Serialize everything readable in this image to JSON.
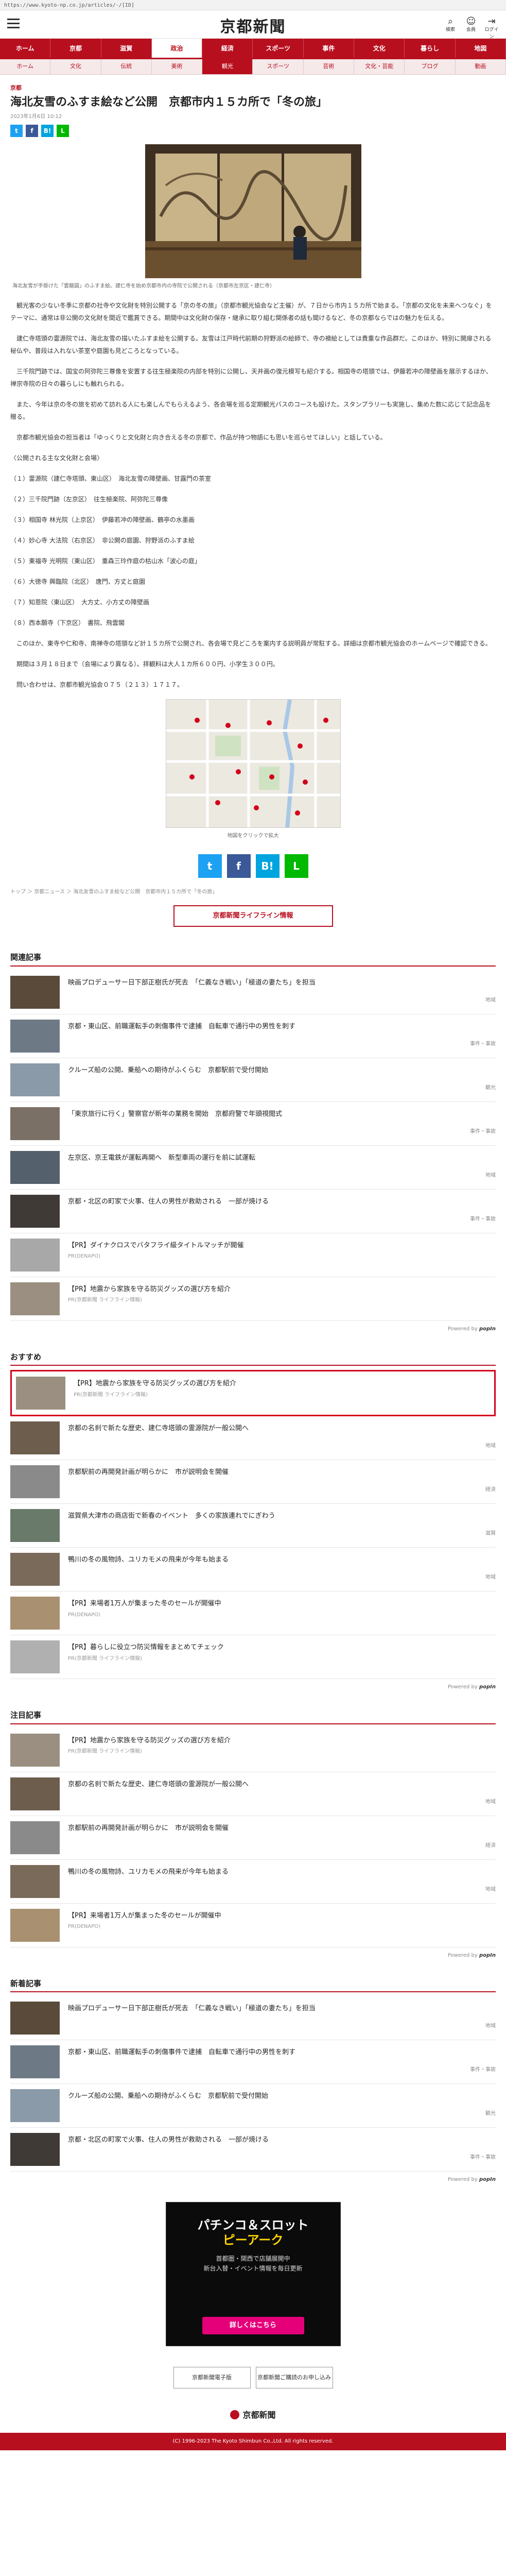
{
  "browser": {
    "url": "https://www.kyoto-np.co.jp/articles/-/[ID]"
  },
  "header": {
    "logo": "京都新聞",
    "icons": [
      {
        "label": "検索",
        "glyph": "⌕"
      },
      {
        "label": "会員",
        "glyph": "☺"
      },
      {
        "label": "ログイン",
        "glyph": "⇥"
      }
    ]
  },
  "global_nav": [
    {
      "label": "ホーム",
      "active": false
    },
    {
      "label": "京都",
      "active": false
    },
    {
      "label": "滋賀",
      "active": false
    },
    {
      "label": "政治",
      "active": true
    },
    {
      "label": "経済",
      "active": false
    },
    {
      "label": "スポーツ",
      "active": false
    },
    {
      "label": "事件",
      "active": false
    },
    {
      "label": "文化",
      "active": false
    },
    {
      "label": "暮らし",
      "active": false
    },
    {
      "label": "地図",
      "active": false
    }
  ],
  "sub_nav": [
    {
      "label": "ホーム",
      "active": false
    },
    {
      "label": "文化",
      "active": false
    },
    {
      "label": "伝統",
      "active": false
    },
    {
      "label": "美術",
      "active": false
    },
    {
      "label": "観光",
      "active": true
    },
    {
      "label": "スポーツ",
      "active": false
    },
    {
      "label": "芸術",
      "active": false
    },
    {
      "label": "文化・芸能",
      "active": false
    },
    {
      "label": "ブログ",
      "active": false
    },
    {
      "label": "動画",
      "active": false
    }
  ],
  "article": {
    "category": "京都",
    "headline": "海北友雪のふすま絵など公開　京都市内１５カ所で「冬の旅」",
    "pubdate": "2023年1月6日 10:12",
    "share": [
      {
        "name": "twitter",
        "glyph": "t",
        "color": "#1da1f2"
      },
      {
        "name": "facebook",
        "glyph": "f",
        "color": "#3b5998"
      },
      {
        "name": "hatena",
        "glyph": "B!",
        "color": "#00a4de"
      },
      {
        "name": "line",
        "glyph": "L",
        "color": "#00b900"
      }
    ],
    "photo_caption": "海北友雪が手掛けた「雲龍図」のふすま絵。建仁寺を始め京都市内の寺院で公開される（京都市左京区・建仁寺）",
    "paragraphs": [
      "観光客の少ない冬季に京都の社寺や文化財を特別公開する「京の冬の旅」（京都市観光協会など主催）が、７日から市内１５カ所で始まる。「京都の文化を未来へつなぐ」をテーマに、通常は非公開の文化財を間近で鑑賞できる。期間中は文化財の保存・継承に取り組む関係者の話も聞けるなど、冬の京都ならではの魅力を伝える。",
      "建仁寺塔頭の霊源院では、海北友雪の描いたふすま絵を公開する。友雪は江戸時代前期の狩野派の絵師で、寺の襖絵としては貴重な作品群だ。このほか、特別に開扉される秘仏や、普段は入れない茶室や庭園も見どころとなっている。",
      "三千院門跡では、国宝の阿弥陀三尊像を安置する往生極楽院の内部を特別に公開し、天井画の復元模写も紹介する。相国寺の塔頭では、伊藤若冲の障壁画を展示するほか、禅宗寺院の日々の暮らしにも触れられる。",
      "また、今年は京の冬の旅を初めて訪れる人にも楽しんでもらえるよう、各会場を巡る定期観光バスのコースも設けた。スタンプラリーも実施し、集めた数に応じて記念品を贈る。",
      "京都市観光協会の担当者は「ゆっくりと文化財と向き合える冬の京都で、作品が持つ物語にも思いを巡らせてほしい」と話している。",
      "〈公開される主な文化財と会場〉",
      "（１）霊源院（建仁寺塔頭、東山区）　海北友雪の障壁画、甘露門の茶室",
      "（２）三千院門跡（左京区）　往生極楽院、阿弥陀三尊像",
      "（３）相国寺 林光院（上京区）　伊藤若冲の障壁画、鶴亭の水墨画",
      "（４）妙心寺 大法院（右京区）　非公開の庭園、狩野派のふすま絵",
      "（５）東福寺 光明院（東山区）　重森三玲作庭の枯山水「波心の庭」",
      "（６）大徳寺 興臨院（北区）　唐門、方丈と庭園",
      "（７）知恩院（東山区）　大方丈、小方丈の障壁画",
      "（８）西本願寺（下京区）　書院、飛雲閣",
      "このほか、東寺や仁和寺、南禅寺の塔頭など計１５カ所で公開され、各会場で見どころを案内する説明員が常駐する。詳細は京都市観光協会のホームページで確認できる。",
      "期間は３月１８日まで（会場により異なる）。拝観料は大人１カ所６００円、小学生３００円。",
      "問い合わせは、京都市観光協会０７５（２１３）１７１７。"
    ],
    "map_caption": "地図をクリックで拡大"
  },
  "breadcrumb": "トップ ＞ 京都ニュース ＞ 海北友雪のふすま絵など公開　京都市内１５カ所で「冬の旅」",
  "lifeinfo_button": "京都新聞ライフライン情報",
  "sections": [
    {
      "title": "関連記事",
      "items": [
        {
          "text": "映画プロデューサー日下部正樹氏が死去　「仁義なき戦い」「極道の妻たち」を担当",
          "meta": "地域",
          "thumb": "#5a4a3a"
        },
        {
          "text": "京都・東山区、前職運転手の刺傷事件で逮捕　自転車で通行中の男性を刺す",
          "meta": "事件・事故",
          "thumb": "#6d7a86"
        },
        {
          "text": "クルーズ船の公開、乗船への期待がふくらむ　京都駅前で受付開始",
          "meta": "観光",
          "thumb": "#8a9aa8"
        },
        {
          "text": "「東京旅行に行く」警察官が新年の業務を開始　京都府警で年頭視閲式",
          "meta": "事件・事故",
          "thumb": "#7b7066"
        },
        {
          "text": "左京区、京王電鉄が運転再開へ　新型車両の運行を前に試運転",
          "meta": "地域",
          "thumb": "#54606b"
        },
        {
          "text": "京都・北区の町家で火事、住人の男性が救助される　一部が焼ける",
          "meta": "事件・事故",
          "thumb": "#3f3a36"
        },
        {
          "text": "【PR】ダイナクロスでバタフライ級タイトルマッチが開催",
          "meta": "",
          "thumb": "#a8a8a8",
          "promo": "PR(DENAPO)"
        },
        {
          "text": "【PR】地震から家族を守る防災グッズの選び方を紹介",
          "meta": "",
          "thumb": "#9a8f80",
          "promo": "PR(京都新聞 ライフライン情報)"
        }
      ]
    },
    {
      "title": "おすすめ",
      "items": [
        {
          "text": "【PR】地震から家族を守る防災グッズの選び方を紹介",
          "meta": "",
          "thumb": "#9a8f80",
          "promo": "PR(京都新聞 ライフライン情報)",
          "highlight": true
        },
        {
          "text": "京都の名刹で新たな歴史、建仁寺塔頭の霊源院が一般公開へ",
          "meta": "地域",
          "thumb": "#6d5d4d"
        },
        {
          "text": "京都駅前の再開発計画が明らかに　市が説明会を開催",
          "meta": "経済",
          "thumb": "#8a8a8a"
        },
        {
          "text": "滋賀県大津市の商店街で新春のイベント　多くの家族連れでにぎわう",
          "meta": "滋賀",
          "thumb": "#6a7a6a"
        },
        {
          "text": "鴨川の冬の風物詩、ユリカモメの飛来が今年も始まる",
          "meta": "地域",
          "thumb": "#7a6a5a"
        },
        {
          "text": "【PR】来場者1万人が集まった冬のセールが開催中",
          "meta": "",
          "thumb": "#a89070",
          "promo": "PR(DENAPO)"
        },
        {
          "text": "【PR】暮らしに役立つ防災情報をまとめてチェック",
          "meta": "",
          "thumb": "#b0b0b0",
          "promo": "PR(京都新聞 ライフライン情報)"
        }
      ]
    },
    {
      "title": "注目記事",
      "items": [
        {
          "text": "【PR】地震から家族を守る防災グッズの選び方を紹介",
          "meta": "",
          "thumb": "#9a8f80",
          "promo": "PR(京都新聞 ライフライン情報)"
        },
        {
          "text": "京都の名刹で新たな歴史、建仁寺塔頭の霊源院が一般公開へ",
          "meta": "地域",
          "thumb": "#6d5d4d"
        },
        {
          "text": "京都駅前の再開発計画が明らかに　市が説明会を開催",
          "meta": "経済",
          "thumb": "#8a8a8a"
        },
        {
          "text": "鴨川の冬の風物詩、ユリカモメの飛来が今年も始まる",
          "meta": "地域",
          "thumb": "#7a6a5a"
        },
        {
          "text": "【PR】来場者1万人が集まった冬のセールが開催中",
          "meta": "",
          "thumb": "#a89070",
          "promo": "PR(DENAPO)"
        }
      ]
    },
    {
      "title": "新着記事",
      "items": [
        {
          "text": "映画プロデューサー日下部正樹氏が死去　「仁義なき戦い」「極道の妻たち」を担当",
          "meta": "地域",
          "thumb": "#5a4a3a"
        },
        {
          "text": "京都・東山区、前職運転手の刺傷事件で逮捕　自転車で通行中の男性を刺す",
          "meta": "事件・事故",
          "thumb": "#6d7a86"
        },
        {
          "text": "クルーズ船の公開、乗船への期待がふくらむ　京都駅前で受付開始",
          "meta": "観光",
          "thumb": "#8a9aa8"
        },
        {
          "text": "京都・北区の町家で火事、住人の男性が救助される　一部が焼ける",
          "meta": "事件・事故",
          "thumb": "#3f3a36"
        }
      ]
    }
  ],
  "powered_by": "Powered by",
  "powered_brand": "popIn",
  "ad": {
    "title_line1": "パチンコ＆スロット",
    "title_line2": "ピーアーク",
    "sub": "首都圏・関西で店舗展開中\n新台入替・イベント情報を毎日更新",
    "button": "詳しくはこちら"
  },
  "footer": {
    "buttons": [
      "京都新聞電子版",
      "京都新聞ご購読のお申し込み"
    ],
    "logo": "京都新聞",
    "copyright": "(C) 1996-2023 The Kyoto Shimbun Co.,Ltd. All rights reserved."
  },
  "colors": {
    "brand": "#b80f1f",
    "highlight": "#d3001b"
  }
}
